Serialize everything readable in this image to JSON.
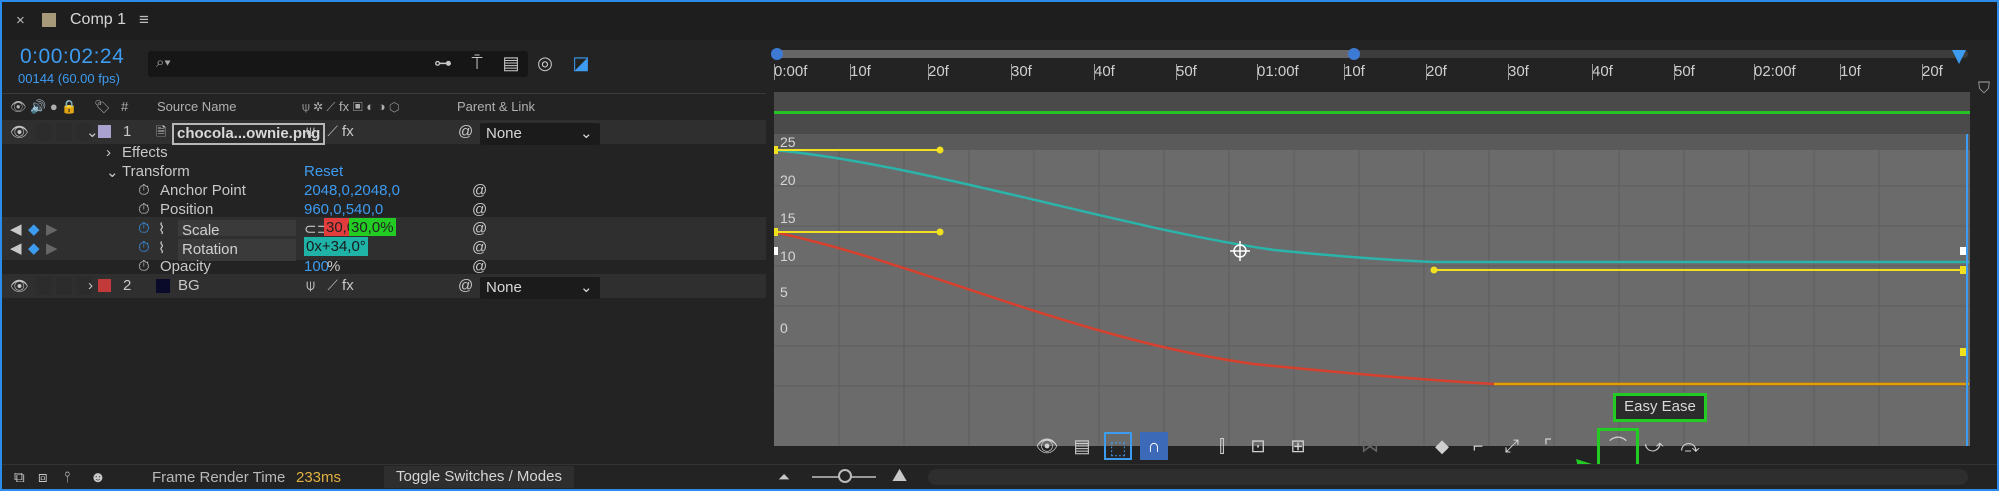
{
  "tab": {
    "close": "×",
    "title": "Comp 1",
    "menu": "≡"
  },
  "header": {
    "timecode": "0:00:02:24",
    "fps": "00144 (60.00 fps)",
    "search_placeholder": "⌕▾"
  },
  "columns": {
    "num": "#",
    "source": "Source Name",
    "parent": "Parent & Link"
  },
  "layers": [
    {
      "num": "1",
      "name": "chocola...ownie.png",
      "parent": "None",
      "color": "#a9a2d0"
    },
    {
      "num": "2",
      "name": "BG",
      "parent": "None",
      "color": "#c23a3a"
    }
  ],
  "props": {
    "effects": "Effects",
    "transform": "Transform",
    "reset": "Reset",
    "anchor": {
      "label": "Anchor Point",
      "value": "2048,0,2048,0"
    },
    "position": {
      "label": "Position",
      "value": "960,0,540,0"
    },
    "scale": {
      "label": "Scale",
      "value1": "30,0,",
      "value2": "30,0%"
    },
    "rotation": {
      "label": "Rotation",
      "value": "0x+34,0°"
    },
    "opacity": {
      "label": "Opacity",
      "value": "100",
      "unit": "%"
    }
  },
  "ruler": {
    "ticks": [
      "0:00f",
      "10f",
      "20f",
      "30f",
      "40f",
      "50f",
      "01:00f",
      "10f",
      "20f",
      "30f",
      "40f",
      "50f",
      "02:00f",
      "10f",
      "20f"
    ]
  },
  "graph": {
    "ylabels": [
      "25",
      "20",
      "15",
      "10",
      "5",
      "0"
    ]
  },
  "tooltip": "Easy Ease",
  "status": {
    "render_label": "Frame Render Time",
    "render_value": "233ms",
    "toggle": "Toggle Switches / Modes"
  },
  "colors": {
    "accent": "#3d9bf0",
    "highlight": "#22cc22",
    "curve_teal": "#2ab4aa",
    "curve_red": "#d8402e",
    "handle": "#f0e020"
  }
}
